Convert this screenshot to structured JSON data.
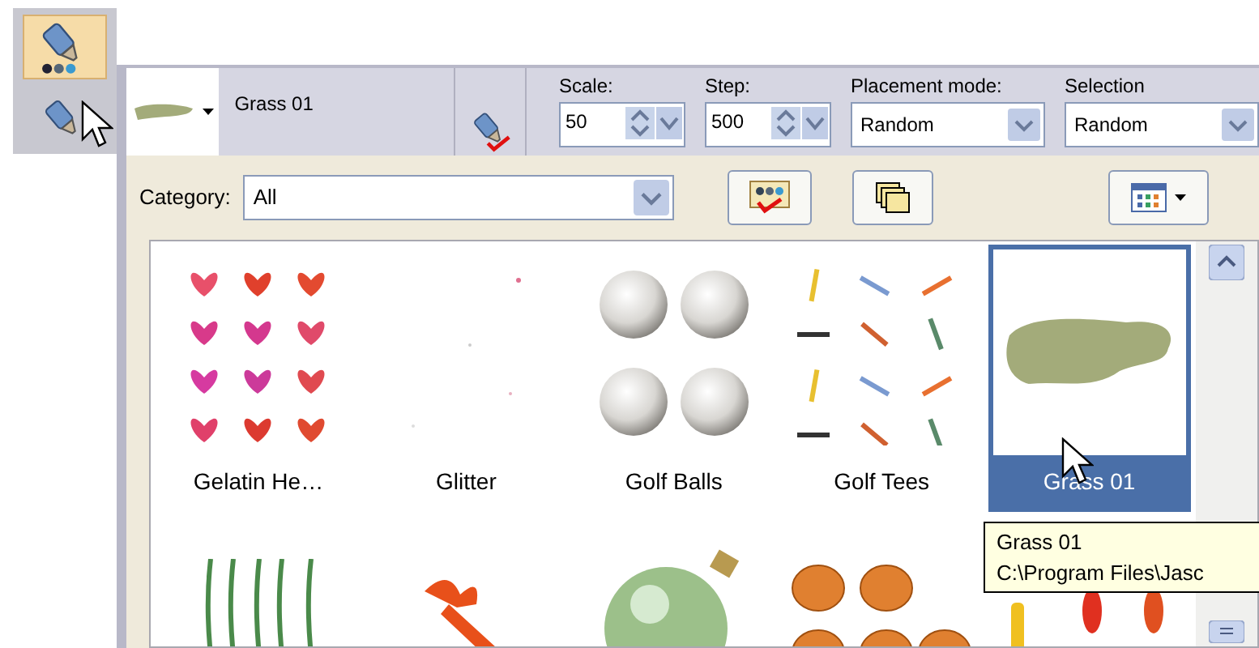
{
  "tool_palette": {
    "tools": [
      {
        "selected": true
      },
      {
        "selected": false
      }
    ]
  },
  "preset": {
    "name": "Grass 01"
  },
  "options": [
    {
      "kind": "spin",
      "label": "Scale:",
      "value": "50"
    },
    {
      "kind": "spin",
      "label": "Step:",
      "value": "500"
    },
    {
      "kind": "select",
      "label": "Placement mode:",
      "value": "Random"
    },
    {
      "kind": "select",
      "label": "Selection",
      "value": "Random"
    }
  ],
  "library": {
    "category_label": "Category:",
    "category": "All",
    "items": [
      {
        "kind": "hearts",
        "label": "Gelatin He…",
        "selected": false
      },
      {
        "kind": "glitter",
        "label": "Glitter",
        "selected": false
      },
      {
        "kind": "balls",
        "label": "Golf Balls",
        "selected": false
      },
      {
        "kind": "tees",
        "label": "Golf Tees",
        "selected": false
      },
      {
        "kind": "grass",
        "label": "Grass 01",
        "selected": true
      },
      {
        "kind": "blades",
        "selected": false
      },
      {
        "kind": "ribbon",
        "selected": false
      },
      {
        "kind": "ornament",
        "selected": false
      },
      {
        "kind": "pumpkins",
        "selected": false
      },
      {
        "kind": "candy",
        "selected": false
      }
    ]
  },
  "tooltip": {
    "lines": [
      "Grass 01",
      "C:\\Program Files\\Jasc"
    ]
  }
}
